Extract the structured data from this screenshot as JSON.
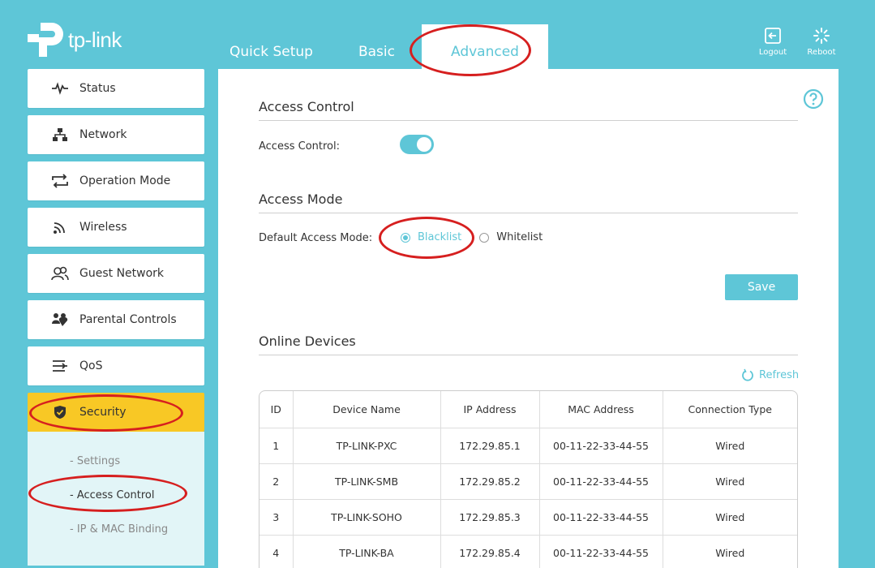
{
  "brand": {
    "name": "tp-link"
  },
  "topnav": {
    "tabs": [
      {
        "label": "Quick Setup"
      },
      {
        "label": "Basic"
      },
      {
        "label": "Advanced"
      }
    ],
    "active_tab": "Advanced"
  },
  "top_actions": {
    "logout_label": "Logout",
    "reboot_label": "Reboot"
  },
  "sidebar": {
    "items": [
      {
        "label": "Status",
        "icon": "pulse-icon"
      },
      {
        "label": "Network",
        "icon": "network-icon"
      },
      {
        "label": "Operation Mode",
        "icon": "swap-icon"
      },
      {
        "label": "Wireless",
        "icon": "wireless-icon"
      },
      {
        "label": "Guest Network",
        "icon": "guests-icon"
      },
      {
        "label": "Parental Controls",
        "icon": "family-icon"
      },
      {
        "label": "QoS",
        "icon": "qos-icon"
      },
      {
        "label": "Security",
        "icon": "shield-icon"
      }
    ],
    "active_item": "Security",
    "submenu": [
      {
        "label": "- Settings"
      },
      {
        "label": "- Access Control"
      },
      {
        "label": "- IP & MAC Binding"
      }
    ],
    "active_subitem": "- Access Control"
  },
  "access_control": {
    "title": "Access Control",
    "toggle_label": "Access Control:",
    "enabled": true
  },
  "access_mode": {
    "title": "Access Mode",
    "mode_label": "Default Access Mode:",
    "options": [
      "Blacklist",
      "Whitelist"
    ],
    "selected": "Blacklist",
    "save_label": "Save"
  },
  "online_devices": {
    "title": "Online Devices",
    "refresh_label": "Refresh",
    "columns": [
      "ID",
      "Device Name",
      "IP Address",
      "MAC Address",
      "Connection Type"
    ],
    "rows": [
      [
        "1",
        "TP-LINK-PXC",
        "172.29.85.1",
        "00-11-22-33-44-55",
        "Wired"
      ],
      [
        "2",
        "TP-LINK-SMB",
        "172.29.85.2",
        "00-11-22-33-44-55",
        "Wired"
      ],
      [
        "3",
        "TP-LINK-SOHO",
        "172.29.85.3",
        "00-11-22-33-44-55",
        "Wired"
      ],
      [
        "4",
        "TP-LINK-BA",
        "172.29.85.4",
        "00-11-22-33-44-55",
        "Wired"
      ]
    ]
  },
  "colors": {
    "accent": "#5ec6d7",
    "active_menu": "#f8c825",
    "annotation": "#d61f1f"
  }
}
